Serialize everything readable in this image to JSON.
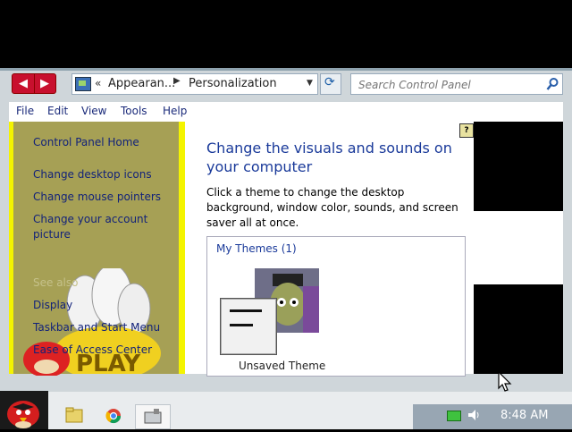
{
  "address_bar": {
    "chevrons": "«",
    "crumbs": [
      "Appearan...",
      "Personalization"
    ]
  },
  "search": {
    "placeholder": "Search Control Panel"
  },
  "menu": [
    "File",
    "Edit",
    "View",
    "Tools",
    "Help"
  ],
  "left_pane": {
    "home_link": "Control Panel Home",
    "tasks": [
      "Change desktop icons",
      "Change mouse pointers",
      "Change your account picture"
    ],
    "see_also_label": "See also",
    "see_also_links": [
      "Display",
      "Taskbar and Start Menu",
      "Ease of Access Center"
    ]
  },
  "main": {
    "title": "Change the visuals and sounds on your computer",
    "description": "Click a theme to change the desktop background, window color, sounds, and screen saver all at once.",
    "themes_heading": "My Themes (1)",
    "theme_name": "Unsaved Theme"
  },
  "taskbar": {
    "clock": "8:48 AM",
    "items": [
      "explorer-icon",
      "chrome-icon",
      "control-panel-icon"
    ]
  },
  "colors": {
    "nav_buttons": "#c8102e",
    "left_pane_bg": "#a6a055",
    "link": "#12227a",
    "title": "#1a3a9a"
  }
}
